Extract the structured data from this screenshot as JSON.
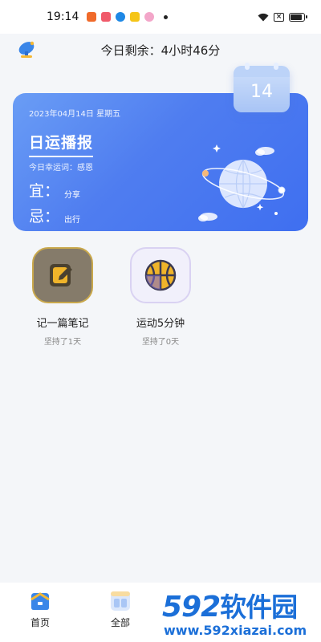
{
  "status_bar": {
    "time": "19:14",
    "notification_icons": [
      "app-notification-icon",
      "video-notification-icon",
      "play-notification-icon",
      "note-notification-icon",
      "flower-notification-icon"
    ],
    "battery_level": 0.7
  },
  "header": {
    "remaining_label": "今日剩余：4小时46分"
  },
  "calendar_badge": {
    "day": "14"
  },
  "fortune_card": {
    "date": "2023年04月14日 星期五",
    "title": "日运播报",
    "lucky_word": "今日幸运词：感恩",
    "yi_label": "宜：",
    "yi_value": "分享",
    "ji_label": "忌：",
    "ji_value": "出行"
  },
  "habits": [
    {
      "name": "记一篇笔记",
      "streak": "坚持了1天",
      "icon": "pencil-note-icon"
    },
    {
      "name": "运动5分钟",
      "streak": "坚持了0天",
      "icon": "basketball-icon"
    }
  ],
  "tab_bar": {
    "tabs": [
      {
        "label": "首页",
        "icon": "home-icon"
      },
      {
        "label": "全部",
        "icon": "grid-icon"
      },
      {
        "label": "",
        "icon": "stats-icon"
      },
      {
        "label": "",
        "icon": "profile-icon"
      }
    ]
  },
  "watermark": {
    "logo_number": "592",
    "logo_text": "软件园",
    "url": "www.592xiazai.com"
  },
  "colors": {
    "card_gradient_start": "#6a9df5",
    "card_gradient_end": "#3f6ff0",
    "page_background": "#f4f6f9",
    "watermark_blue": "#1b6fd8"
  }
}
